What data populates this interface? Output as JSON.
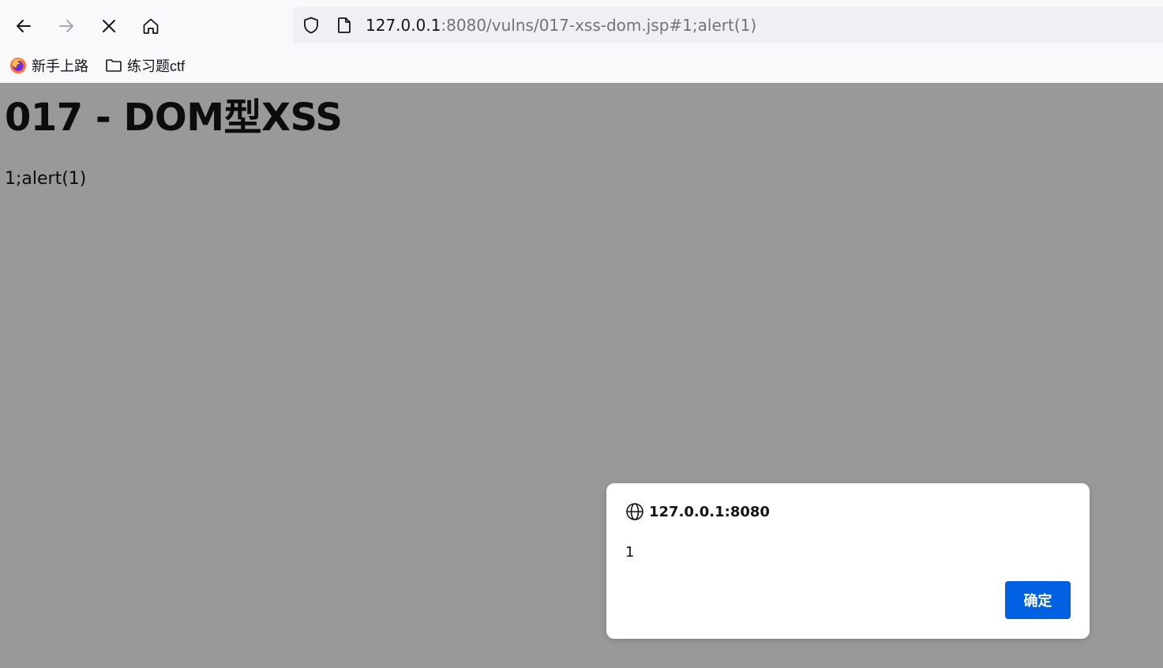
{
  "toolbar": {
    "back_icon": "arrow-left-icon",
    "forward_icon": "arrow-right-icon",
    "stop_icon": "close-icon",
    "home_icon": "home-icon"
  },
  "urlbar": {
    "shield_icon": "shield-icon",
    "page_icon": "page-icon",
    "host": "127.0.0.1",
    "rest": ":8080/vulns/017-xss-dom.jsp#1;alert(1)"
  },
  "bookmarks": [
    {
      "label": "新手上路",
      "icon": "firefox-icon"
    },
    {
      "label": "练习题ctf",
      "icon": "folder-icon"
    }
  ],
  "page": {
    "heading": "017 - DOM型XSS",
    "output": "1;alert(1)"
  },
  "dialog": {
    "origin": "127.0.0.1:8080",
    "message": "1",
    "ok_label": "确定",
    "icon": "globe-icon"
  },
  "colors": {
    "chrome_bg": "#f9f9fb",
    "urlbar_bg": "#f0f0f4",
    "page_overlay": "#999999",
    "accent": "#0061e0"
  }
}
